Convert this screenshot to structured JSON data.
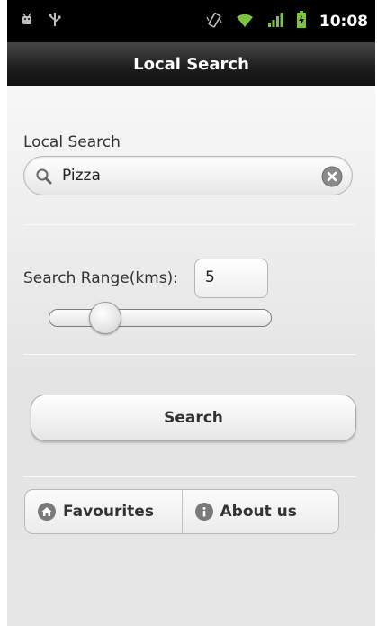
{
  "status_bar": {
    "time": "10:08",
    "icons": [
      "android-debug-icon",
      "usb-icon",
      "vibrate-icon",
      "wifi-icon",
      "signal-icon",
      "battery-charging-icon"
    ]
  },
  "title_bar": {
    "title": "Local Search"
  },
  "search": {
    "label": "Local Search",
    "value": "Pizza"
  },
  "range": {
    "label": "Search Range(kms):",
    "value": "5",
    "slider_fraction": 0.12
  },
  "search_button": {
    "label": "Search"
  },
  "segments": [
    {
      "label": "Favourites",
      "icon": "home-icon"
    },
    {
      "label": "About us",
      "icon": "info-icon"
    }
  ],
  "colors": {
    "status_green": "#7dc242",
    "title_bg": "#1d1d1d"
  }
}
